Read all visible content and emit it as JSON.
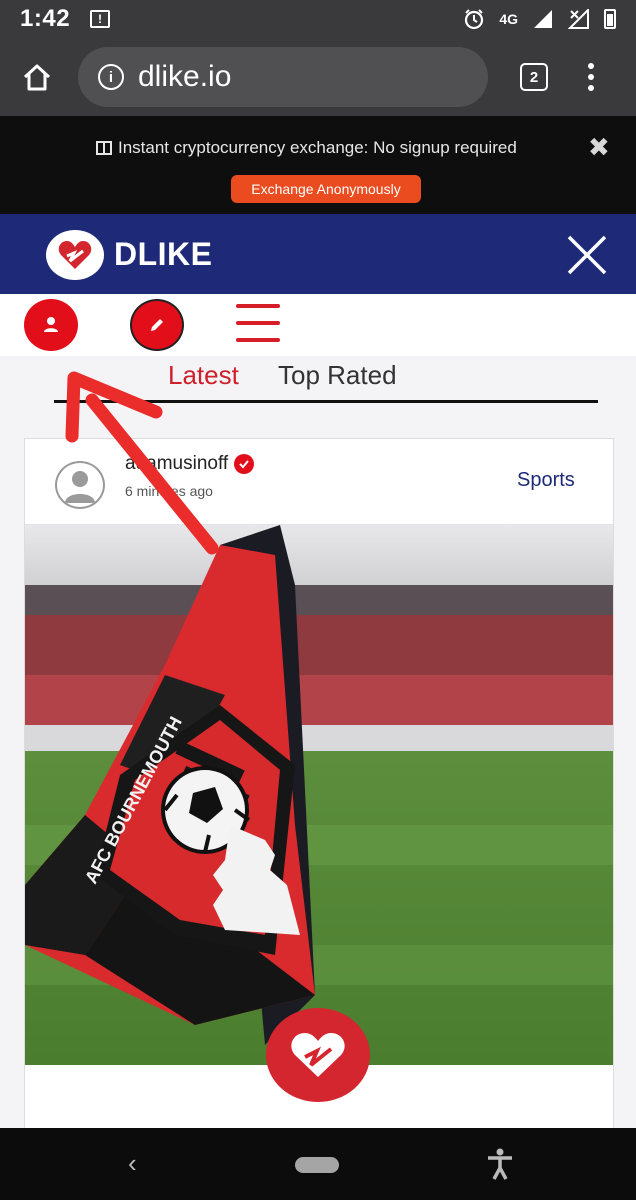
{
  "status_bar": {
    "time": "1:42",
    "alert_glyph": "!",
    "network": "4G"
  },
  "browser": {
    "url": "dlike.io",
    "tab_count": "2",
    "icons": [
      "home-icon",
      "info-icon",
      "tabs-icon",
      "more-vert-icon"
    ]
  },
  "promo": {
    "text": "Instant cryptocurrency exchange: No signup required",
    "button": "Exchange Anonymously",
    "close": "✖",
    "button_color": "#ea4b1f"
  },
  "header": {
    "brand": "DLIKE",
    "brand_color": "#1e2a78",
    "accent": "#e20f1b"
  },
  "tabs": {
    "latest": "Latest",
    "top_rated": "Top Rated"
  },
  "post": {
    "author": "adamusinoff",
    "time": "6 minutes ago",
    "category": "Sports",
    "image_desc_icon": "afc-bournemouth-flag-image"
  },
  "nav": {
    "back": "‹"
  }
}
